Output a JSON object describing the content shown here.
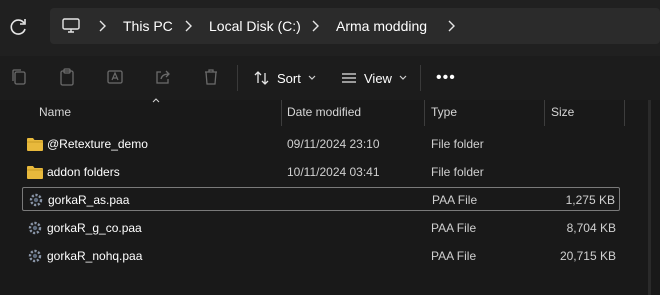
{
  "breadcrumb": {
    "items": [
      "This PC",
      "Local Disk (C:)",
      "Arma modding"
    ]
  },
  "toolbar": {
    "sort_label": "Sort",
    "view_label": "View",
    "more_label": "•••"
  },
  "columns": {
    "name": "Name",
    "date": "Date modified",
    "type": "Type",
    "size": "Size"
  },
  "files": [
    {
      "name": "@Retexture_demo",
      "date": "09/11/2024 23:10",
      "type": "File folder",
      "size": "",
      "icon": "folder-icon"
    },
    {
      "name": "addon folders",
      "date": "10/11/2024 03:41",
      "type": "File folder",
      "size": "",
      "icon": "folder-icon"
    },
    {
      "name": "gorkaR_as.paa",
      "date": "",
      "type": "PAA File",
      "size": "1,275 KB",
      "icon": "paa-file-icon",
      "selected": true
    },
    {
      "name": "gorkaR_g_co.paa",
      "date": "",
      "type": "PAA File",
      "size": "8,704 KB",
      "icon": "paa-file-icon"
    },
    {
      "name": "gorkaR_nohq.paa",
      "date": "",
      "type": "PAA File",
      "size": "20,715 KB",
      "icon": "paa-file-icon"
    }
  ],
  "colors": {
    "background": "#191919",
    "folder": "#e8b93c",
    "text": "#ffffff"
  }
}
